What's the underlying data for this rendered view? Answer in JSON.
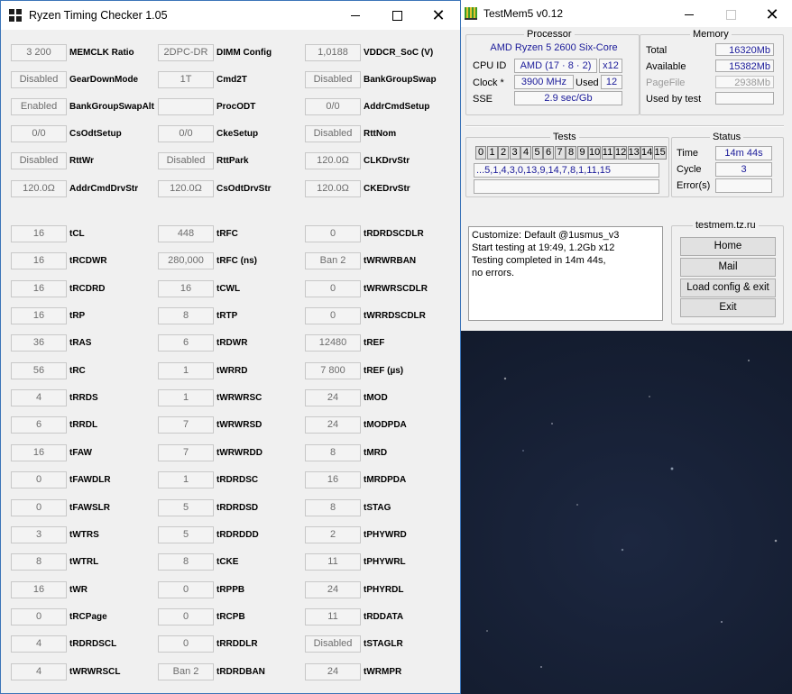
{
  "rtc": {
    "title": "Ryzen Timing Checker 1.05",
    "rows": [
      [
        {
          "v": "3 200",
          "l": "MEMCLK Ratio"
        },
        {
          "v": "2DPC-DR",
          "l": "DIMM Config"
        },
        {
          "v": "1,0188",
          "l": "VDDCR_SoC (V)"
        }
      ],
      [
        {
          "v": "Disabled",
          "l": "GearDownMode"
        },
        {
          "v": "1T",
          "l": "Cmd2T"
        },
        {
          "v": "Disabled",
          "l": "BankGroupSwap"
        }
      ],
      [
        {
          "v": "Enabled",
          "l": "BankGroupSwapAlt"
        },
        {
          "v": "",
          "l": "ProcODT"
        },
        {
          "v": "0/0",
          "l": "AddrCmdSetup"
        }
      ],
      [
        {
          "v": "0/0",
          "l": "CsOdtSetup"
        },
        {
          "v": "0/0",
          "l": "CkeSetup"
        },
        {
          "v": "Disabled",
          "l": "RttNom"
        }
      ],
      [
        {
          "v": "Disabled",
          "l": "RttWr"
        },
        {
          "v": "Disabled",
          "l": "RttPark"
        },
        {
          "v": "120.0Ω",
          "l": "CLKDrvStr"
        }
      ],
      [
        {
          "v": "120.0Ω",
          "l": "AddrCmdDrvStr"
        },
        {
          "v": "120.0Ω",
          "l": "CsOdtDrvStr"
        },
        {
          "v": "120.0Ω",
          "l": "CKEDrvStr"
        }
      ],
      [
        {
          "v": "16",
          "l": "tCL"
        },
        {
          "v": "448",
          "l": "tRFC"
        },
        {
          "v": "0",
          "l": "tRDRDSCDLR"
        }
      ],
      [
        {
          "v": "16",
          "l": "tRCDWR"
        },
        {
          "v": "280,000",
          "l": "tRFC (ns)"
        },
        {
          "v": "Ban 2",
          "l": "tWRWRBAN"
        }
      ],
      [
        {
          "v": "16",
          "l": "tRCDRD"
        },
        {
          "v": "16",
          "l": "tCWL"
        },
        {
          "v": "0",
          "l": "tWRWRSCDLR"
        }
      ],
      [
        {
          "v": "16",
          "l": "tRP"
        },
        {
          "v": "8",
          "l": "tRTP"
        },
        {
          "v": "0",
          "l": "tWRRDSCDLR"
        }
      ],
      [
        {
          "v": "36",
          "l": "tRAS"
        },
        {
          "v": "6",
          "l": "tRDWR"
        },
        {
          "v": "12480",
          "l": "tREF"
        }
      ],
      [
        {
          "v": "56",
          "l": "tRC"
        },
        {
          "v": "1",
          "l": "tWRRD"
        },
        {
          "v": "7 800",
          "l": "tREF (µs)"
        }
      ],
      [
        {
          "v": "4",
          "l": "tRRDS"
        },
        {
          "v": "1",
          "l": "tWRWRSC"
        },
        {
          "v": "24",
          "l": "tMOD"
        }
      ],
      [
        {
          "v": "6",
          "l": "tRRDL"
        },
        {
          "v": "7",
          "l": "tWRWRSD"
        },
        {
          "v": "24",
          "l": "tMODPDA"
        }
      ],
      [
        {
          "v": "16",
          "l": "tFAW"
        },
        {
          "v": "7",
          "l": "tWRWRDD"
        },
        {
          "v": "8",
          "l": "tMRD"
        }
      ],
      [
        {
          "v": "0",
          "l": "tFAWDLR"
        },
        {
          "v": "1",
          "l": "tRDRDSC"
        },
        {
          "v": "16",
          "l": "tMRDPDA"
        }
      ],
      [
        {
          "v": "0",
          "l": "tFAWSLR"
        },
        {
          "v": "5",
          "l": "tRDRDSD"
        },
        {
          "v": "8",
          "l": "tSTAG"
        }
      ],
      [
        {
          "v": "3",
          "l": "tWTRS"
        },
        {
          "v": "5",
          "l": "tRDRDDD"
        },
        {
          "v": "2",
          "l": "tPHYWRD"
        }
      ],
      [
        {
          "v": "8",
          "l": "tWTRL"
        },
        {
          "v": "8",
          "l": "tCKE"
        },
        {
          "v": "11",
          "l": "tPHYWRL"
        }
      ],
      [
        {
          "v": "16",
          "l": "tWR"
        },
        {
          "v": "0",
          "l": "tRPPB"
        },
        {
          "v": "24",
          "l": "tPHYRDL"
        }
      ],
      [
        {
          "v": "0",
          "l": "tRCPage"
        },
        {
          "v": "0",
          "l": "tRCPB"
        },
        {
          "v": "11",
          "l": "tRDDATA"
        }
      ],
      [
        {
          "v": "4",
          "l": "tRDRDSCL"
        },
        {
          "v": "0",
          "l": "tRRDDLR"
        },
        {
          "v": "Disabled",
          "l": "tSTAGLR"
        }
      ],
      [
        {
          "v": "4",
          "l": "tWRWRSCL"
        },
        {
          "v": "Ban 2",
          "l": "tRDRDBAN"
        },
        {
          "v": "24",
          "l": "tWRMPR"
        }
      ]
    ]
  },
  "tm5": {
    "title": "TestMem5 v0.12",
    "processor": {
      "group": "Processor",
      "name": "AMD Ryzen 5 2600 Six-Core",
      "cpuid_label": "CPU ID",
      "cpuid_value": "AMD  (17 · 8 · 2)",
      "cpuid_threads": "x12",
      "clock_label": "Clock *",
      "clock_value": "3900 MHz",
      "used_label": "Used",
      "used_value": "12",
      "sse_label": "SSE",
      "sse_value": "2.9 sec/Gb"
    },
    "memory": {
      "group": "Memory",
      "total_label": "Total",
      "total_value": "16320Mb",
      "available_label": "Available",
      "available_value": "15382Mb",
      "pagefile_label": "PageFile",
      "pagefile_value": "2938Mb",
      "usedbytest_label": "Used by test",
      "usedbytest_value": ""
    },
    "tests": {
      "group": "Tests",
      "cells": [
        "0",
        "1",
        "2",
        "3",
        "4",
        "5",
        "6",
        "7",
        "8",
        "9",
        "10",
        "11",
        "12",
        "13",
        "14",
        "15"
      ],
      "sequence": "...5,1,4,3,0,13,9,14,7,8,1,11,15",
      "progress": ""
    },
    "status": {
      "group": "Status",
      "time_label": "Time",
      "time_value": "14m 44s",
      "cycle_label": "Cycle",
      "cycle_value": "3",
      "errors_label": "Error(s)",
      "errors_value": ""
    },
    "log": [
      "Customize: Default @1usmus_v3",
      "Start testing at 19:49, 1.2Gb x12",
      "Testing completed in 14m 44s,",
      "no errors."
    ],
    "links": {
      "group": "testmem.tz.ru",
      "home": "Home",
      "mail": "Mail",
      "load": "Load config & exit",
      "exit": "Exit"
    }
  }
}
